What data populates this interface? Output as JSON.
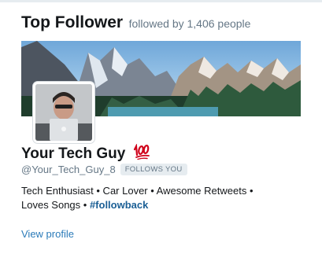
{
  "card": {
    "title": "Top Follower",
    "subtitle": "followed by 1,406 people"
  },
  "profile": {
    "display_name": "Your Tech Guy",
    "emoji": "hundred-points-emoji",
    "handle": "@Your_Tech_Guy_8",
    "follows_badge": "FOLLOWS YOU",
    "bio_line1": "Tech Enthusiast • Car Lover • Awesome Retweets •",
    "bio_line2": "Loves Songs • ",
    "hashtag": "#followback",
    "view_profile": "View profile"
  },
  "colors": {
    "link": "#2b7bb9",
    "hashtag": "#1b5f95",
    "secondary_text": "#657786",
    "badge_bg": "#e6ecf0"
  }
}
